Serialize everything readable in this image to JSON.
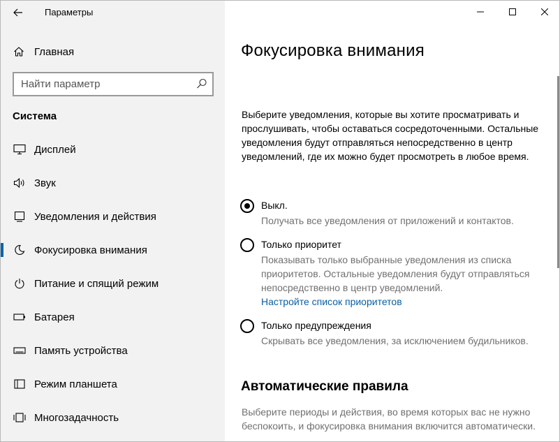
{
  "window": {
    "title": "Параметры"
  },
  "sidebar": {
    "home_label": "Главная",
    "search_placeholder": "Найти параметр",
    "section_title": "Система",
    "items": [
      {
        "label": "Дисплей",
        "icon": "display-icon"
      },
      {
        "label": "Звук",
        "icon": "sound-icon"
      },
      {
        "label": "Уведомления и действия",
        "icon": "notifications-icon"
      },
      {
        "label": "Фокусировка внимания",
        "icon": "moon-icon",
        "active": true
      },
      {
        "label": "Питание и спящий режим",
        "icon": "power-icon"
      },
      {
        "label": "Батарея",
        "icon": "battery-icon"
      },
      {
        "label": "Память устройства",
        "icon": "storage-icon"
      },
      {
        "label": "Режим планшета",
        "icon": "tablet-icon"
      },
      {
        "label": "Многозадачность",
        "icon": "multitasking-icon"
      }
    ]
  },
  "main": {
    "title": "Фокусировка внимания",
    "description": "Выберите уведомления, которые вы хотите просматривать и прослушивать, чтобы оставаться сосредоточенными. Остальные уведомления будут отправляться непосредственно в центр уведомлений, где их можно будет просмотреть в любое время.",
    "options": [
      {
        "label": "Выкл.",
        "description": "Получать все уведомления от приложений и контактов.",
        "checked": true
      },
      {
        "label": "Только приоритет",
        "description": "Показывать только выбранные уведомления из списка приоритетов. Остальные уведомления будут отправляться непосредственно в центр уведомлений.",
        "link": "Настройте список приоритетов",
        "checked": false
      },
      {
        "label": "Только предупреждения",
        "description": "Скрывать все уведомления, за исключением будильников.",
        "checked": false
      }
    ],
    "auto_rules_title": "Автоматические правила",
    "auto_rules_description": "Выберите периоды и действия, во время которых вас не нужно беспокоить, и фокусировка внимания включится автоматически."
  },
  "colors": {
    "sidebar_bg": "#f2f2f2",
    "accent": "#0063b1",
    "link": "#0a5ea3",
    "secondary_text": "#707070"
  }
}
